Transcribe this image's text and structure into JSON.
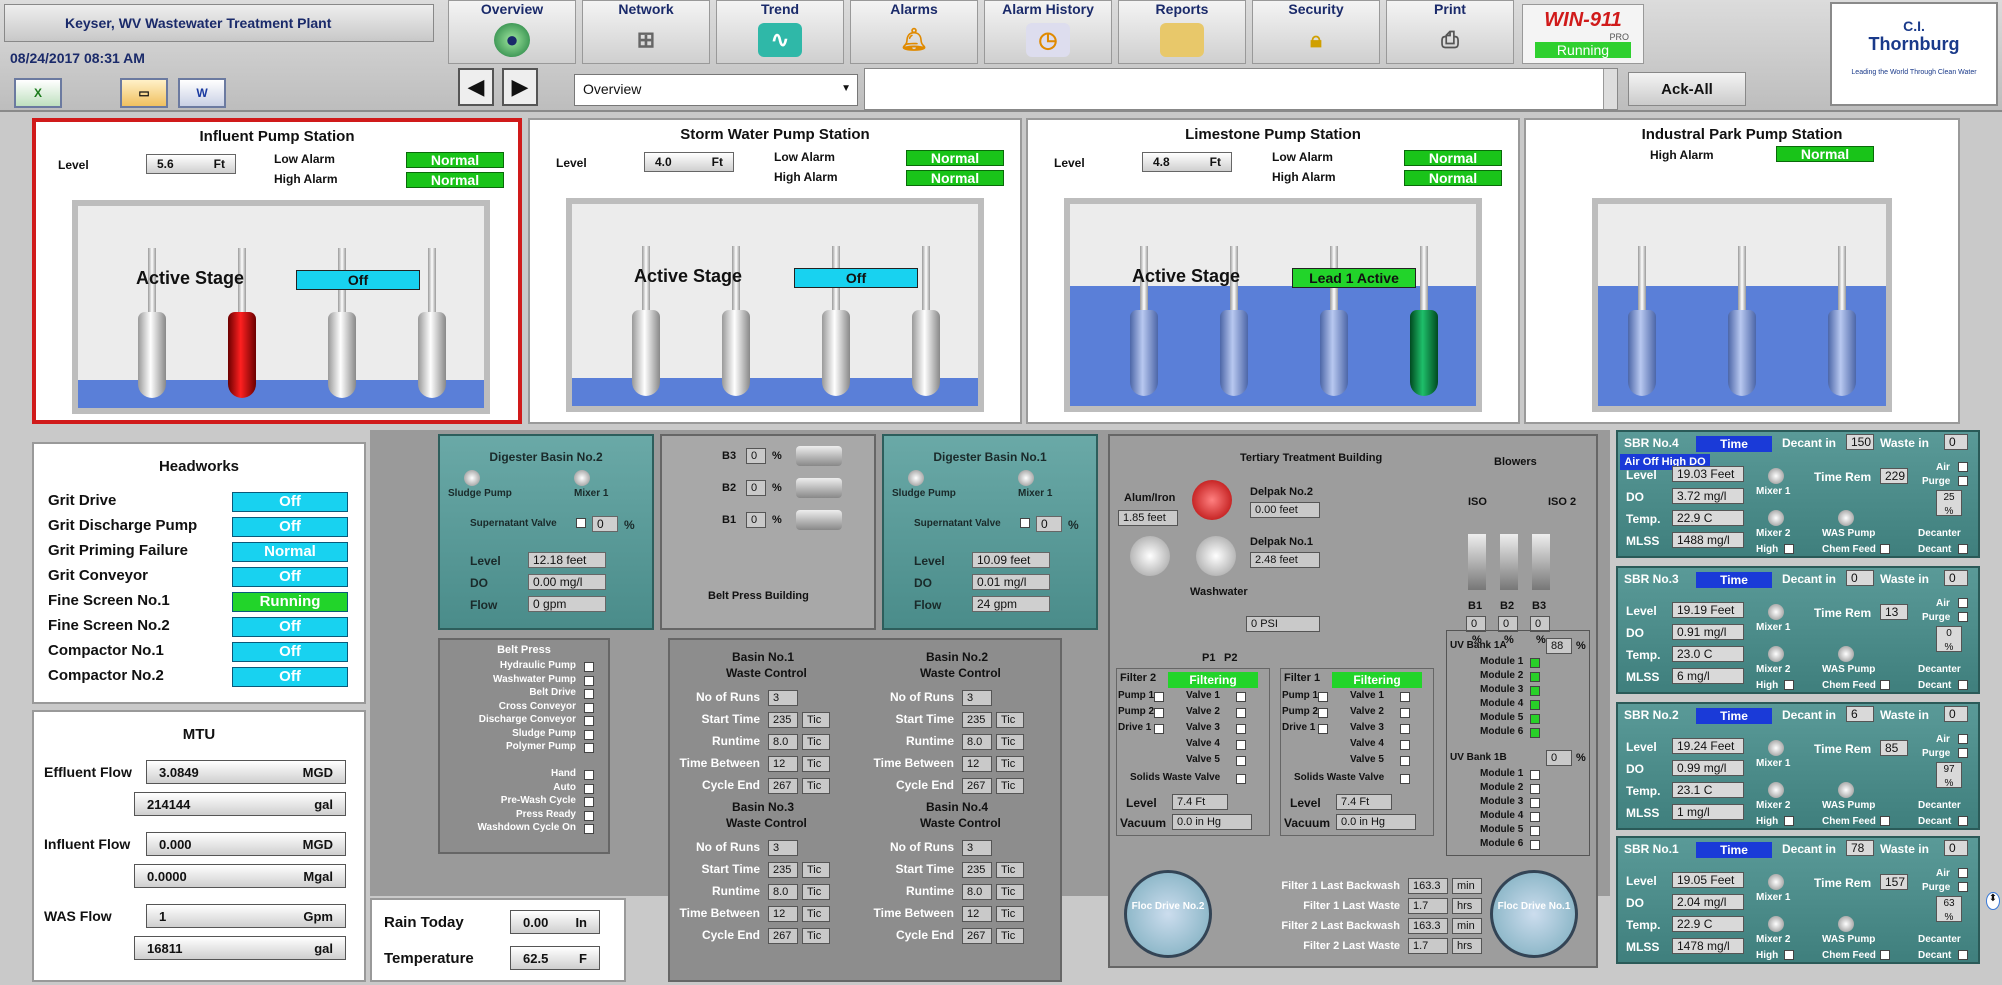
{
  "header": {
    "plant_name": "Keyser, WV Wastewater Treatment Plant",
    "datetime": "08/24/2017   08:31 AM",
    "quick_buttons": [
      "X",
      "",
      "W"
    ],
    "nav": [
      {
        "label": "Overview",
        "icon": "globe-icon"
      },
      {
        "label": "Network",
        "icon": "network-icon"
      },
      {
        "label": "Trend",
        "icon": "trend-icon"
      },
      {
        "label": "Alarms",
        "icon": "bell-icon"
      },
      {
        "label": "Alarm History",
        "icon": "clock-icon"
      },
      {
        "label": "Reports",
        "icon": "folder-icon"
      },
      {
        "label": "Security",
        "icon": "lock-icon"
      },
      {
        "label": "Print",
        "icon": "printer-icon"
      }
    ],
    "win911": {
      "brand": "WIN-911",
      "edition": "PRO",
      "status": "Running"
    },
    "screen_select": "Overview",
    "ack_all": "Ack-All",
    "logo": {
      "line1": "C.I.",
      "line2": "Thornburg",
      "tagline": "Leading the World Through Clean Water"
    }
  },
  "stations": [
    {
      "title": "Influent Pump Station",
      "level_label": "Level",
      "level": "5.6",
      "unit": "Ft",
      "low_alarm_label": "Low Alarm",
      "low_alarm": "Normal",
      "high_alarm_label": "High Alarm",
      "high_alarm": "Normal",
      "active_label": "Active Stage",
      "active": "Off"
    },
    {
      "title": "Storm Water Pump Station",
      "level_label": "Level",
      "level": "4.0",
      "unit": "Ft",
      "low_alarm_label": "Low Alarm",
      "low_alarm": "Normal",
      "high_alarm_label": "High Alarm",
      "high_alarm": "Normal",
      "active_label": "Active Stage",
      "active": "Off"
    },
    {
      "title": "Limestone Pump Station",
      "level_label": "Level",
      "level": "4.8",
      "unit": "Ft",
      "low_alarm_label": "Low Alarm",
      "low_alarm": "Normal",
      "high_alarm_label": "High Alarm",
      "high_alarm": "Normal",
      "active_label": "Active Stage",
      "active": "Lead 1 Active"
    },
    {
      "title": "Industral Park Pump Station",
      "high_alarm_label": "High Alarm",
      "high_alarm": "Normal"
    }
  ],
  "headworks": {
    "title": "Headworks",
    "rows": [
      {
        "label": "Grit Drive",
        "value": "Off"
      },
      {
        "label": "Grit Discharge Pump",
        "value": "Off"
      },
      {
        "label": "Grit Priming Failure",
        "value": "Normal"
      },
      {
        "label": "Grit Conveyor",
        "value": "Off"
      },
      {
        "label": "Fine Screen No.1",
        "value": "Running"
      },
      {
        "label": "Fine Screen No.2",
        "value": "Off"
      },
      {
        "label": "Compactor No.1",
        "value": "Off"
      },
      {
        "label": "Compactor No.2",
        "value": "Off"
      }
    ]
  },
  "mtu": {
    "title": "MTU",
    "effluent_label": "Effluent Flow",
    "effluent": "3.0849",
    "effluent_unit": "MGD",
    "effluent_total": "214144",
    "effluent_total_unit": "gal",
    "influent_label": "Influent Flow",
    "influent": "0.000",
    "influent_unit": "MGD",
    "influent_total": "0.0000",
    "influent_total_unit": "Mgal",
    "was_label": "WAS Flow",
    "was": "1",
    "was_unit": "Gpm",
    "was_total": "16811",
    "was_total_unit": "gal"
  },
  "weather": {
    "rain_label": "Rain Today",
    "rain": "0.00",
    "rain_unit": "In",
    "temp_label": "Temperature",
    "temp": "62.5",
    "temp_unit": "F"
  },
  "digester2": {
    "title": "Digester Basin No.2",
    "sludge": "Sludge Pump",
    "mixer": "Mixer 1",
    "supernatant": "Supernatant Valve",
    "sup_val": "0",
    "pct": "%",
    "level_label": "Level",
    "level": "12.18",
    "level_unit": "feet",
    "do_label": "DO",
    "do": "0.00",
    "do_unit": "mg/l",
    "flow_label": "Flow",
    "flow": "0",
    "flow_unit": "gpm"
  },
  "digester1": {
    "title": "Digester Basin No.1",
    "sludge": "Sludge Pump",
    "mixer": "Mixer 1",
    "supernatant": "Supernatant Valve",
    "sup_val": "0",
    "pct": "%",
    "level_label": "Level",
    "level": "10.09",
    "level_unit": "feet",
    "do_label": "DO",
    "do": "0.01",
    "do_unit": "mg/l",
    "flow_label": "Flow",
    "flow": "24",
    "flow_unit": "gpm"
  },
  "beltpress_bldg": {
    "title": "Belt Press Building",
    "rows": [
      {
        "label": "B3",
        "value": "0"
      },
      {
        "label": "B2",
        "value": "0"
      },
      {
        "label": "B1",
        "value": "0"
      }
    ],
    "pct": "%"
  },
  "beltpress": {
    "title": "Belt Press",
    "items": [
      "Hydraulic Pump",
      "Washwater Pump",
      "Belt Drive",
      "Cross Conveyor",
      "Discharge Conveyor",
      "Sludge Pump",
      "Polymer Pump",
      "",
      "Hand",
      "Auto",
      "Pre-Wash Cycle",
      "Press Ready",
      "Washdown Cycle On"
    ]
  },
  "basins": [
    {
      "title": "Basin No.1",
      "sub": "Waste Control",
      "runs_label": "No of Runs",
      "runs": "3",
      "start_label": "Start Time",
      "start": "235",
      "run_label": "Runtime",
      "runtime": "8.0",
      "between_label": "Time Between",
      "between": "12",
      "end_label": "Cycle End",
      "end": "267",
      "unit": "Tic"
    },
    {
      "title": "Basin No.2",
      "sub": "Waste Control",
      "runs_label": "No of Runs",
      "runs": "3",
      "start_label": "Start Time",
      "start": "235",
      "run_label": "Runtime",
      "runtime": "8.0",
      "between_label": "Time Between",
      "between": "12",
      "end_label": "Cycle End",
      "end": "267",
      "unit": "Tic"
    },
    {
      "title": "Basin No.3",
      "sub": "Waste Control",
      "runs_label": "No of Runs",
      "runs": "3",
      "start_label": "Start Time",
      "start": "235",
      "run_label": "Runtime",
      "runtime": "8.0",
      "between_label": "Time Between",
      "between": "12",
      "end_label": "Cycle End",
      "end": "267",
      "unit": "Tic"
    },
    {
      "title": "Basin No.4",
      "sub": "Waste Control",
      "runs_label": "No of Runs",
      "runs": "3",
      "start_label": "Start Time",
      "start": "235",
      "run_label": "Runtime",
      "runtime": "8.0",
      "between_label": "Time Between",
      "between": "12",
      "end_label": "Cycle End",
      "end": "267",
      "unit": "Tic"
    }
  ],
  "tertiary": {
    "title": "Tertiary Treatment  Building",
    "blowers": "Blowers",
    "iso1": "ISO",
    "iso2": "ISO 2",
    "blower_labels": [
      "B1",
      "B2",
      "B3"
    ],
    "blower_vals": [
      "0",
      "0",
      "0"
    ],
    "blower_pct": [
      "%",
      "%",
      "%"
    ],
    "alum_label": "Alum/Iron",
    "alum": "1.85",
    "alum_unit": "feet",
    "delpak2_label": "Delpak No.2",
    "delpak2": "0.00",
    "delpak2_unit": "feet",
    "delpak1_label": "Delpak No.1",
    "delpak1": "2.48",
    "delpak1_unit": "feet",
    "washwater": "Washwater",
    "p1": "P1",
    "p2": "P2",
    "psi": "0",
    "psi_unit": "PSI",
    "filter2": {
      "label": "Filter 2",
      "status": "Filtering",
      "level": "7.4",
      "level_unit": "Ft",
      "vacuum": "0.0",
      "vac_unit": "in Hg"
    },
    "filter1": {
      "label": "Filter 1",
      "status": "Filtering",
      "level": "7.4",
      "level_unit": "Ft",
      "vacuum": "0.0",
      "vac_unit": "in Hg"
    },
    "filter_items_left": [
      "Pump 1",
      "Pump 2",
      "Drive 1"
    ],
    "filter_valves": [
      "Valve 1",
      "Valve 2",
      "Valve 3",
      "Valve 4",
      "Valve 5"
    ],
    "solids": "Solids Waste Valve",
    "level_label": "Level",
    "vacuum_label": "Vacuum",
    "uv1a": "UV Bank 1A",
    "uv1a_val": "88",
    "uv1b": "UV Bank 1B",
    "uv1b_val": "0",
    "uv_pct": "%",
    "modules": [
      "Module 1",
      "Module 2",
      "Module 3",
      "Module 4",
      "Module 5",
      "Module 6"
    ],
    "floc2": "Floc Drive No.2",
    "floc1": "Floc Drive No.1",
    "backwash": [
      {
        "label": "Filter 1 Last Backwash",
        "value": "163.3",
        "unit": "min"
      },
      {
        "label": "Filter 1 Last Waste",
        "value": "1.7",
        "unit": "hrs"
      },
      {
        "label": "Filter 2 Last Backwash",
        "value": "163.3",
        "unit": "min"
      },
      {
        "label": "Filter 2 Last Waste",
        "value": "1.7",
        "unit": "hrs"
      }
    ]
  },
  "sbr": [
    {
      "title": "SBR No.4",
      "mode": "Time",
      "decant_label": "Decant in",
      "decant": "150",
      "waste_label": "Waste in",
      "waste": "0",
      "alert": "Air Off High DO",
      "level": "19.03",
      "level_unit": "Feet",
      "do": "3.72",
      "do_unit": "mg/l",
      "temp": "22.9",
      "temp_unit": "C",
      "mlss": "1488",
      "mlss_unit": "mg/l",
      "time_rem": "229",
      "purge": "25",
      "labels": {
        "level": "Level",
        "do": "DO",
        "temp": "Temp.",
        "mlss": "MLSS",
        "time_rem": "Time Rem",
        "mixer1": "Mixer 1",
        "mixer2": "Mixer 2",
        "was": "WAS Pump",
        "high": "High",
        "chem": "Chem Feed",
        "decant": "Decant",
        "decanter": "Decanter",
        "air": "Air",
        "purge": "Purge",
        "pct": "%"
      }
    },
    {
      "title": "SBR No.3",
      "mode": "Time",
      "decant_label": "Decant in",
      "decant": "0",
      "waste_label": "Waste in",
      "waste": "0",
      "alert": "",
      "level": "19.19",
      "level_unit": "Feet",
      "do": "0.91",
      "do_unit": "mg/l",
      "temp": "23.0",
      "temp_unit": "C",
      "mlss": "6",
      "mlss_unit": "mg/l",
      "time_rem": "13",
      "purge": "0",
      "labels": {
        "level": "Level",
        "do": "DO",
        "temp": "Temp.",
        "mlss": "MLSS",
        "time_rem": "Time Rem",
        "mixer1": "Mixer 1",
        "mixer2": "Mixer 2",
        "was": "WAS Pump",
        "high": "High",
        "chem": "Chem Feed",
        "decant": "Decant",
        "decanter": "Decanter",
        "air": "Air",
        "purge": "Purge",
        "pct": "%"
      }
    },
    {
      "title": "SBR No.2",
      "mode": "Time",
      "decant_label": "Decant in",
      "decant": "6",
      "waste_label": "Waste in",
      "waste": "0",
      "alert": "",
      "level": "19.24",
      "level_unit": "Feet",
      "do": "0.99",
      "do_unit": "mg/l",
      "temp": "23.1",
      "temp_unit": "C",
      "mlss": "1",
      "mlss_unit": "mg/l",
      "time_rem": "85",
      "purge": "97",
      "labels": {
        "level": "Level",
        "do": "DO",
        "temp": "Temp.",
        "mlss": "MLSS",
        "time_rem": "Time Rem",
        "mixer1": "Mixer 1",
        "mixer2": "Mixer 2",
        "was": "WAS Pump",
        "high": "High",
        "chem": "Chem Feed",
        "decant": "Decant",
        "decanter": "Decanter",
        "air": "Air",
        "purge": "Purge",
        "pct": "%"
      }
    },
    {
      "title": "SBR No.1",
      "mode": "Time",
      "decant_label": "Decant in",
      "decant": "78",
      "waste_label": "Waste in",
      "waste": "0",
      "alert": "",
      "level": "19.05",
      "level_unit": "Feet",
      "do": "2.04",
      "do_unit": "mg/l",
      "temp": "22.9",
      "temp_unit": "C",
      "mlss": "1478",
      "mlss_unit": "mg/l",
      "time_rem": "157",
      "purge": "63",
      "labels": {
        "level": "Level",
        "do": "DO",
        "temp": "Temp.",
        "mlss": "MLSS",
        "time_rem": "Time Rem",
        "mixer1": "Mixer 1",
        "mixer2": "Mixer 2",
        "was": "WAS Pump",
        "high": "High",
        "chem": "Chem Feed",
        "decant": "Decant",
        "decanter": "Decanter",
        "air": "Air",
        "purge": "Purge",
        "pct": "%"
      }
    }
  ],
  "colors": {
    "normal": "#19c419",
    "off": "#18d2f0",
    "selected_border": "#d01a1a",
    "water": "#5a7fd8"
  }
}
